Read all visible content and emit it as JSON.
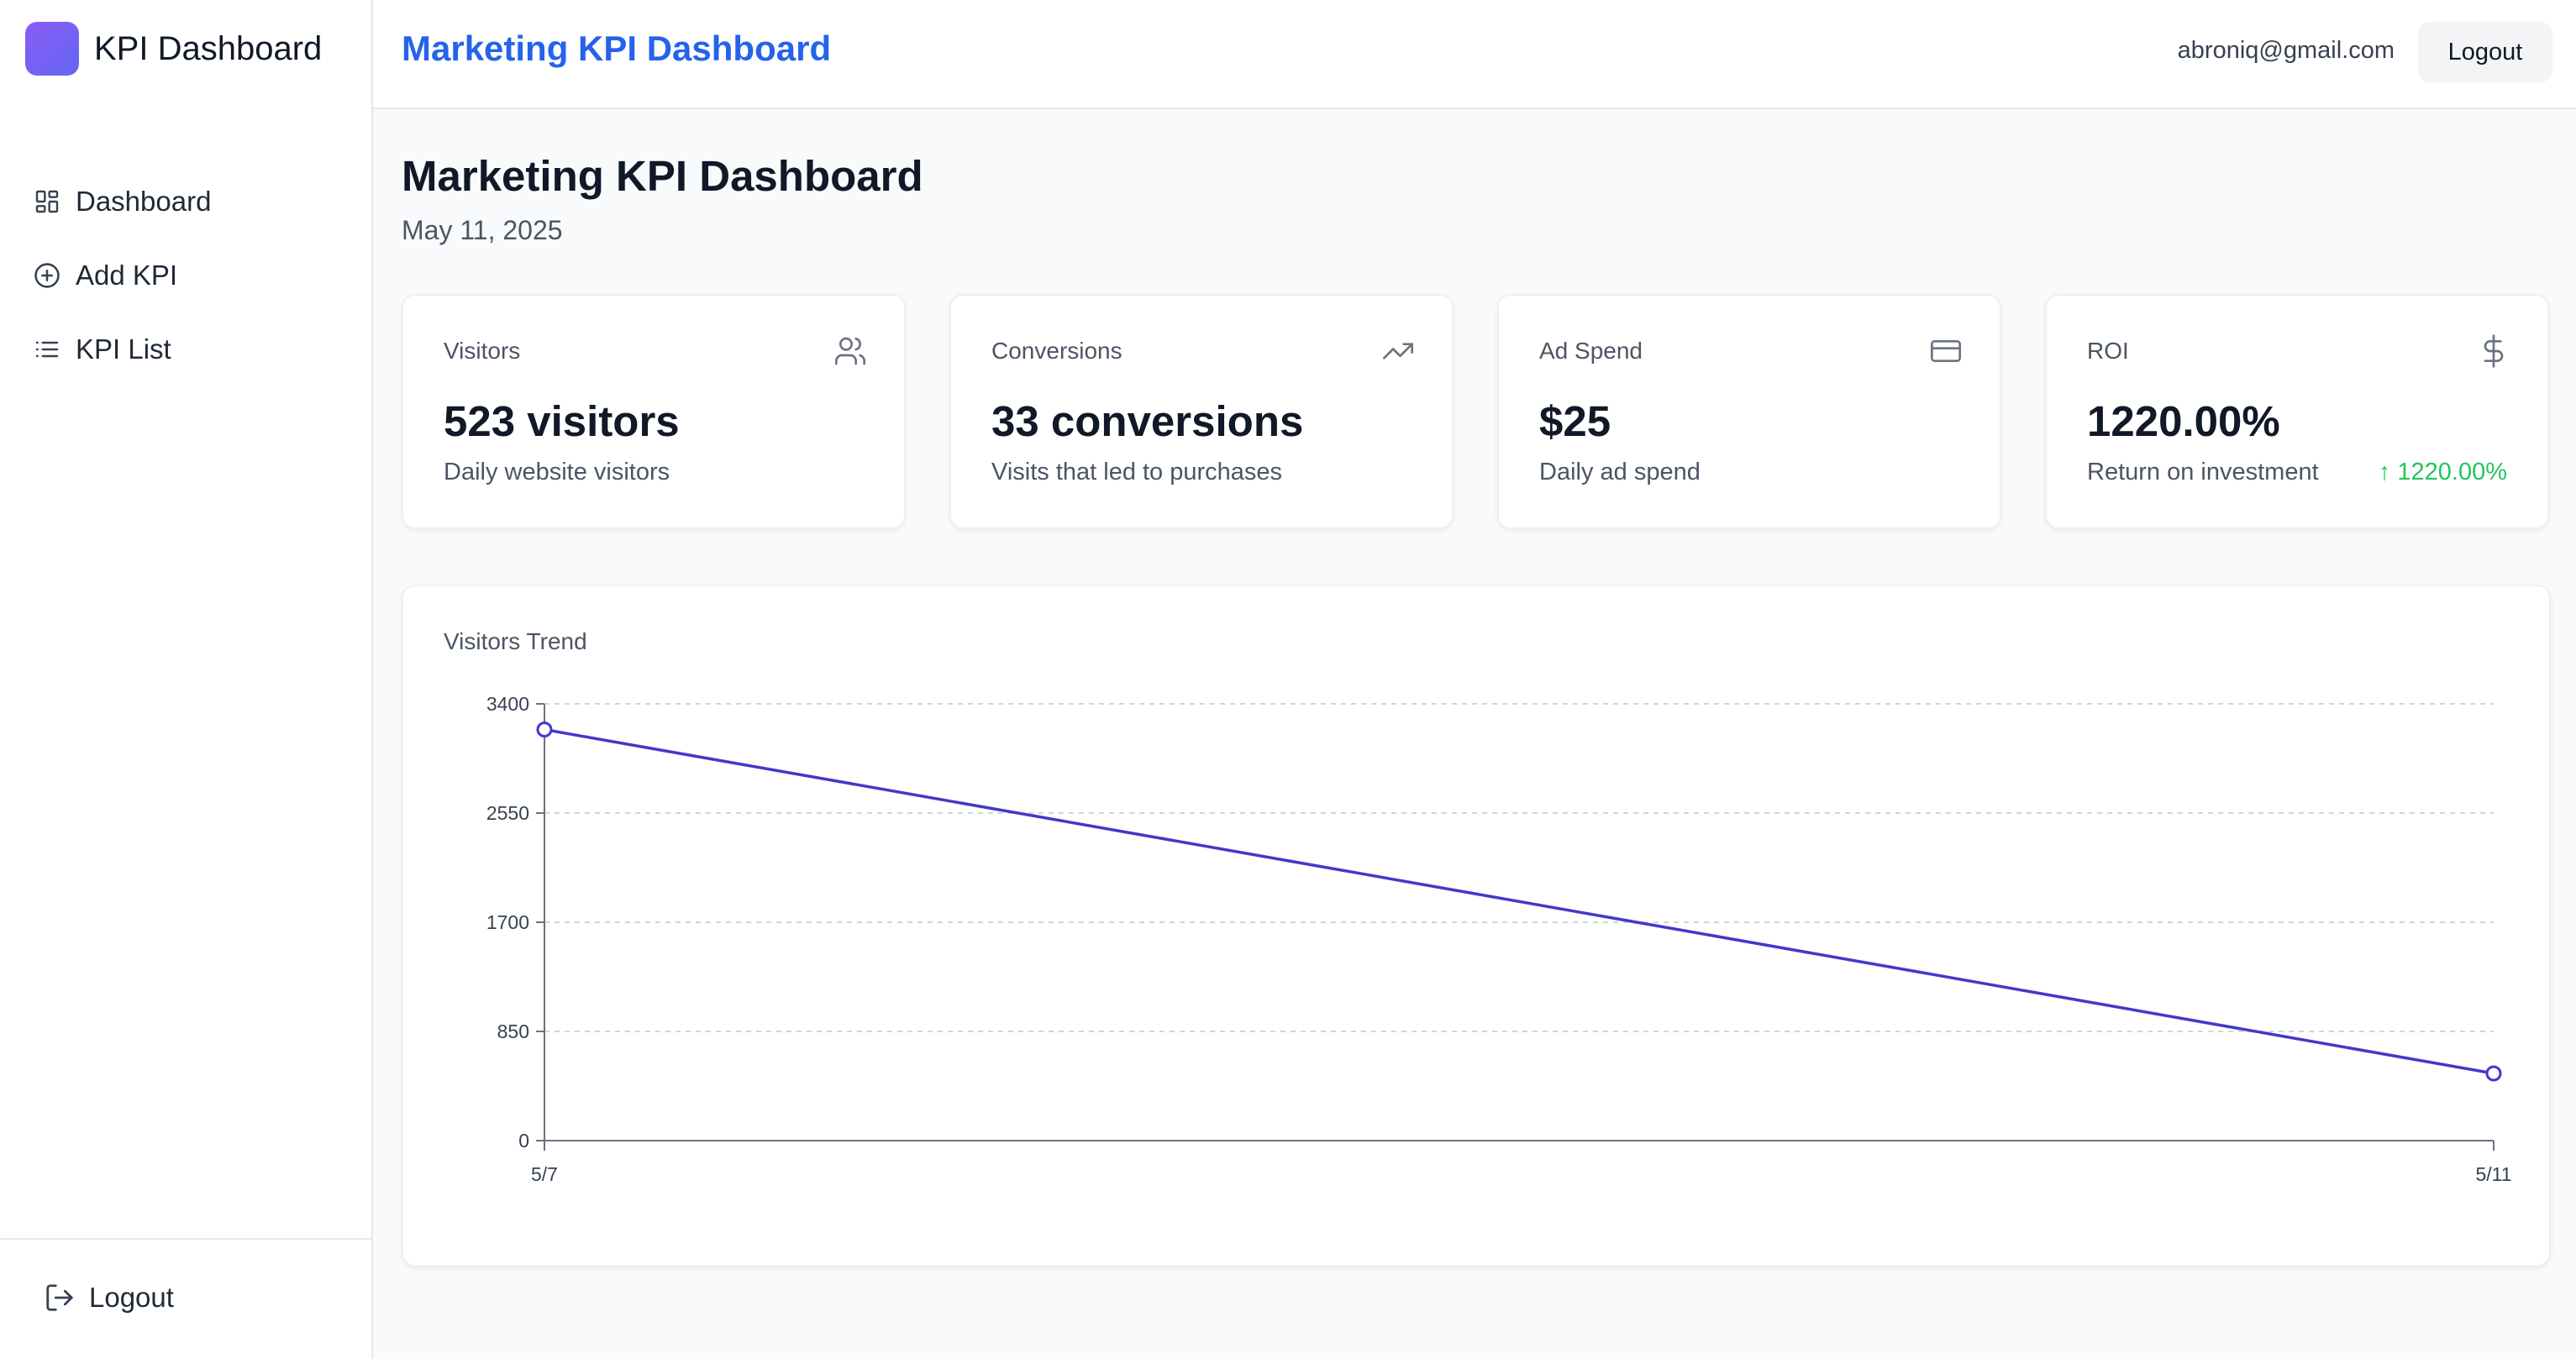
{
  "sidebar": {
    "brand": "KPI Dashboard",
    "items": [
      {
        "label": "Dashboard",
        "icon": "dashboard-grid-icon"
      },
      {
        "label": "Add KPI",
        "icon": "plus-circle-icon"
      },
      {
        "label": "KPI List",
        "icon": "list-icon"
      }
    ],
    "logout_label": "Logout"
  },
  "header": {
    "title": "Marketing KPI Dashboard",
    "user_email": "abroniq@gmail.com",
    "logout_label": "Logout"
  },
  "page": {
    "heading": "Marketing KPI Dashboard",
    "date": "May 11, 2025"
  },
  "cards": [
    {
      "label": "Visitors",
      "value": "523 visitors",
      "description": "Daily website visitors",
      "icon": "users-icon"
    },
    {
      "label": "Conversions",
      "value": "33 conversions",
      "description": "Visits that led to purchases",
      "icon": "trending-up-icon"
    },
    {
      "label": "Ad Spend",
      "value": "$25",
      "description": "Daily ad spend",
      "icon": "credit-card-icon"
    },
    {
      "label": "ROI",
      "value": "1220.00%",
      "description": "Return on investment",
      "icon": "dollar-icon",
      "trend": "↑ 1220.00%"
    }
  ],
  "colors": {
    "accent": "#2563eb",
    "line": "#4338ca",
    "positive": "#22c55e"
  },
  "chart_data": {
    "type": "line",
    "title": "Visitors Trend",
    "x": [
      "5/7",
      "5/11"
    ],
    "series": [
      {
        "values": [
          3200,
          523
        ]
      }
    ],
    "yticks": [
      0,
      850,
      1700,
      2550,
      3400
    ],
    "ylim": [
      0,
      3400
    ],
    "grid": true
  }
}
